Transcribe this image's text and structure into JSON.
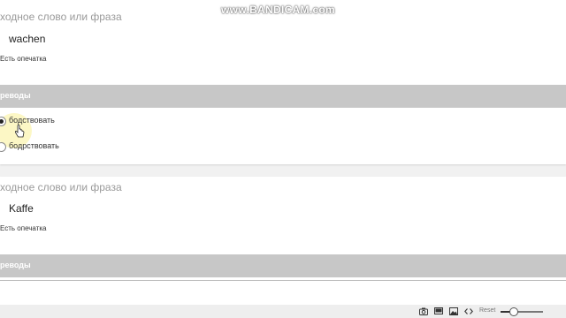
{
  "watermark": "www.BANDICAM.com",
  "cards": [
    {
      "source_label": "ходное слово или фраза",
      "word": "wachen",
      "typo_label": "Есть опечатка",
      "section_title": "реводы",
      "options": [
        {
          "label": "бодствовать",
          "checked": true
        },
        {
          "label": "бодрствовать",
          "checked": false
        }
      ]
    },
    {
      "source_label": "ходное слово или фраза",
      "word": "Kaffe",
      "typo_label": "Есть опечатка",
      "section_title": "реводы"
    }
  ],
  "toolbar": {
    "reset_label": "Reset",
    "icons": [
      "camera-icon",
      "screen-icon",
      "image-icon",
      "code-icon"
    ],
    "zoom_fraction": 0.25
  }
}
